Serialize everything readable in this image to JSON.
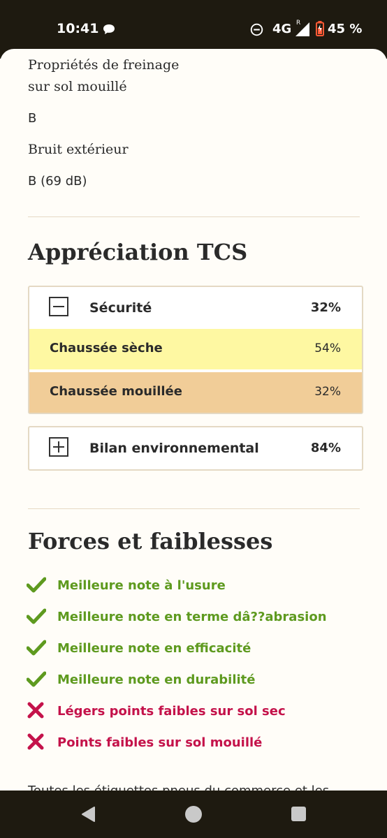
{
  "status_bar": {
    "time": "10:41",
    "network": "4G",
    "roaming": "R",
    "battery": "45 %"
  },
  "specs": {
    "wet_braking_label_line1": "Propriétés de freinage",
    "wet_braking_label_line2": "sur sol mouillé",
    "wet_braking_value": "B",
    "noise_label": "Bruit extérieur",
    "noise_value": "B (69 dB)"
  },
  "rating": {
    "title": "Appréciation TCS",
    "security": {
      "title": "Sécurité",
      "score": "32%",
      "rows": [
        {
          "label": "Chaussée sèche",
          "score": "54%"
        },
        {
          "label": "Chaussée mouillée",
          "score": "32%"
        }
      ]
    },
    "environment": {
      "title": "Bilan environnemental",
      "score": "84%"
    }
  },
  "strengths_weaknesses": {
    "title": "Forces et faiblesses",
    "items": [
      {
        "type": "strength",
        "text": "Meilleure note à l'usure"
      },
      {
        "type": "strength",
        "text": "Meilleure note en terme dâ??abrasion"
      },
      {
        "type": "strength",
        "text": "Meilleure note en efficacité"
      },
      {
        "type": "strength",
        "text": "Meilleure note en durabilité"
      },
      {
        "type": "weakness",
        "text": "Légers points faibles sur sol sec"
      },
      {
        "type": "weakness",
        "text": "Points faibles sur sol mouillé"
      }
    ]
  },
  "trailing_text": "Toutes les étiquettes pneus du commerce et les",
  "colors": {
    "strength": "#5e9a1f",
    "weakness": "#c4124a",
    "dry_row": "#fef8a2",
    "wet_row": "#f1cd98"
  }
}
